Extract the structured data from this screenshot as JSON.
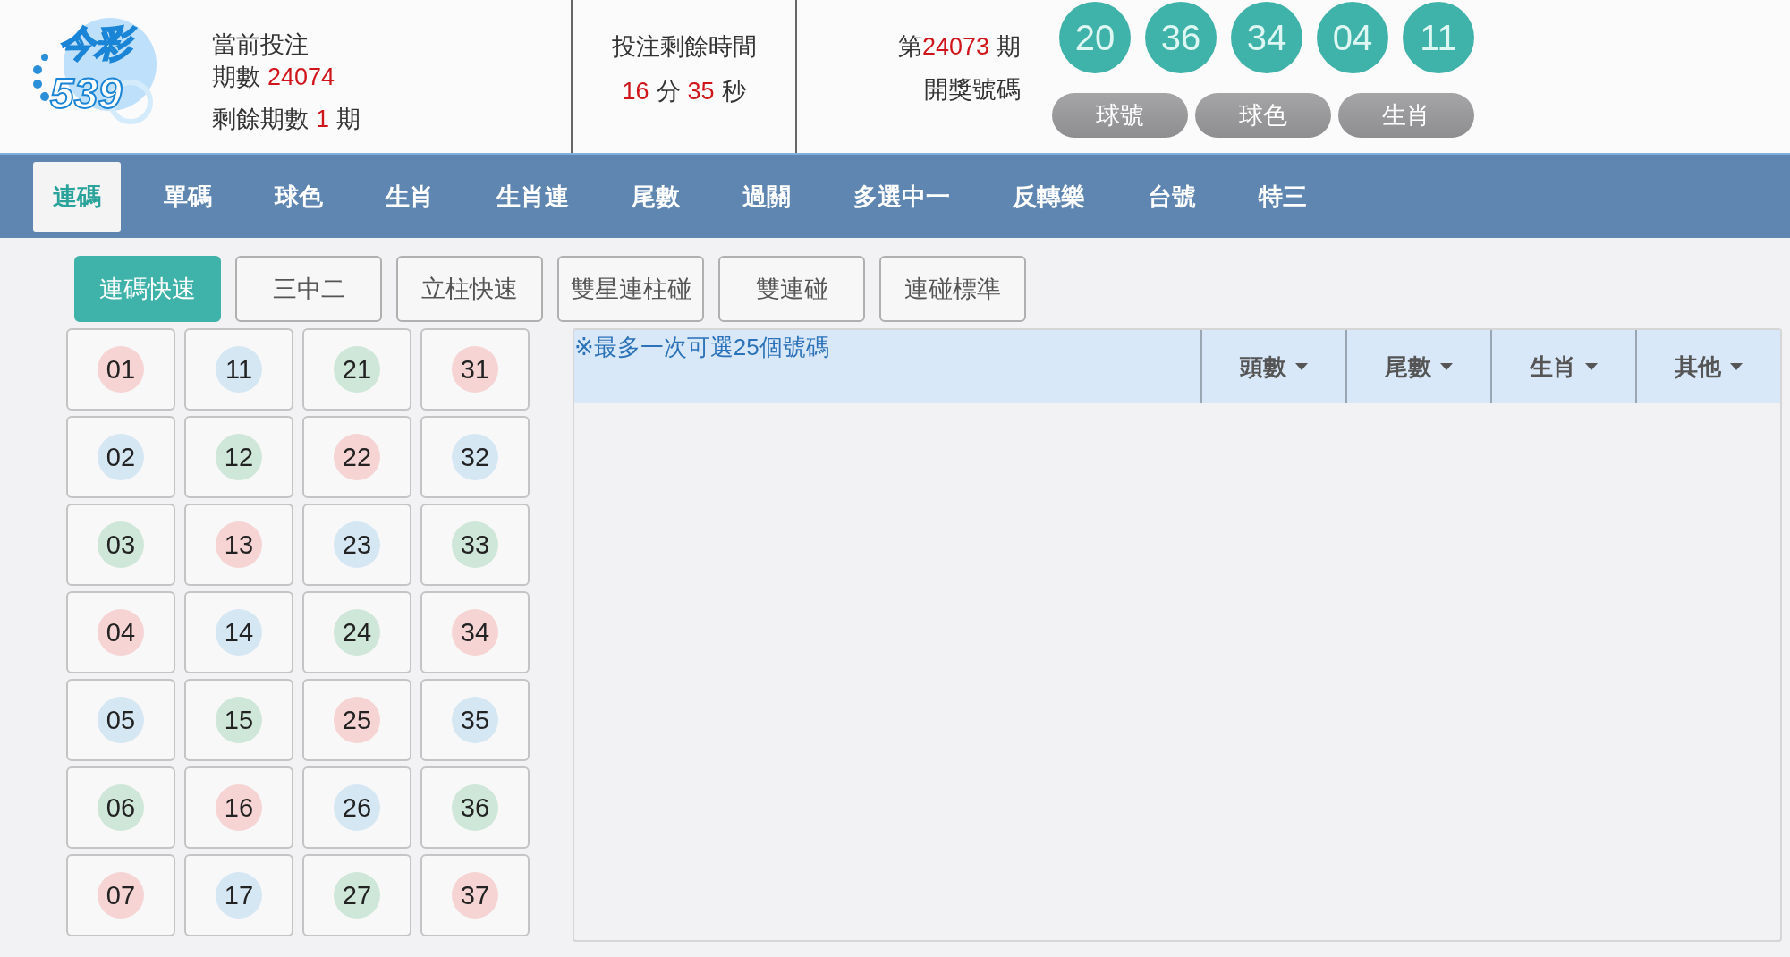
{
  "logo": {
    "line1": "今彩",
    "line2": "539"
  },
  "current_bet": {
    "title": "當前投注",
    "period_label": "期數",
    "period": "24074",
    "remaining_label": "剩餘期數",
    "remaining": "1",
    "remaining_unit": "期"
  },
  "countdown": {
    "title": "投注剩餘時間",
    "minutes": "16",
    "minutes_unit": "分",
    "seconds": "35",
    "seconds_unit": "秒"
  },
  "last_draw": {
    "prefix": "第",
    "period": "24073",
    "suffix": "期",
    "label": "開獎號碼",
    "balls": [
      "20",
      "36",
      "34",
      "04",
      "11"
    ],
    "view_buttons": [
      {
        "label": "球號",
        "selected": false
      },
      {
        "label": "球色",
        "selected": false
      },
      {
        "label": "生肖",
        "selected": false
      }
    ]
  },
  "nav_tabs": [
    {
      "label": "連碼",
      "selected": true
    },
    {
      "label": "單碼",
      "selected": false
    },
    {
      "label": "球色",
      "selected": false
    },
    {
      "label": "生肖",
      "selected": false
    },
    {
      "label": "生肖連",
      "selected": false
    },
    {
      "label": "尾數",
      "selected": false
    },
    {
      "label": "過關",
      "selected": false
    },
    {
      "label": "多選中一",
      "selected": false
    },
    {
      "label": "反轉樂",
      "selected": false
    },
    {
      "label": "台號",
      "selected": false
    },
    {
      "label": "特三",
      "selected": false
    }
  ],
  "sub_tabs": [
    {
      "label": "連碼快速",
      "selected": true
    },
    {
      "label": "三中二",
      "selected": false
    },
    {
      "label": "立柱快速",
      "selected": false
    },
    {
      "label": "雙星連柱碰",
      "selected": false
    },
    {
      "label": "雙連碰",
      "selected": false
    },
    {
      "label": "連碰標準",
      "selected": false
    }
  ],
  "number_grid": [
    {
      "number": "01",
      "color": "#f6d4d4"
    },
    {
      "number": "11",
      "color": "#d6e7f4"
    },
    {
      "number": "21",
      "color": "#cfe7d9"
    },
    {
      "number": "31",
      "color": "#f6d4d4"
    },
    {
      "number": "02",
      "color": "#d6e7f4"
    },
    {
      "number": "12",
      "color": "#cfe7d9"
    },
    {
      "number": "22",
      "color": "#f6d4d4"
    },
    {
      "number": "32",
      "color": "#d6e7f4"
    },
    {
      "number": "03",
      "color": "#cfe7d9"
    },
    {
      "number": "13",
      "color": "#f6d4d4"
    },
    {
      "number": "23",
      "color": "#d6e7f4"
    },
    {
      "number": "33",
      "color": "#cfe7d9"
    },
    {
      "number": "04",
      "color": "#f6d4d4"
    },
    {
      "number": "14",
      "color": "#d6e7f4"
    },
    {
      "number": "24",
      "color": "#cfe7d9"
    },
    {
      "number": "34",
      "color": "#f6d4d4"
    },
    {
      "number": "05",
      "color": "#d6e7f4"
    },
    {
      "number": "15",
      "color": "#cfe7d9"
    },
    {
      "number": "25",
      "color": "#f6d4d4"
    },
    {
      "number": "35",
      "color": "#d6e7f4"
    },
    {
      "number": "06",
      "color": "#cfe7d9"
    },
    {
      "number": "16",
      "color": "#f6d4d4"
    },
    {
      "number": "26",
      "color": "#d6e7f4"
    },
    {
      "number": "36",
      "color": "#cfe7d9"
    },
    {
      "number": "07",
      "color": "#f6d4d4"
    },
    {
      "number": "17",
      "color": "#d6e7f4"
    },
    {
      "number": "27",
      "color": "#cfe7d9"
    },
    {
      "number": "37",
      "color": "#f6d4d4"
    }
  ],
  "selection_panel": {
    "note": "※最多一次可選25個號碼",
    "filters": [
      "頭數",
      "尾數",
      "生肖",
      "其他"
    ]
  }
}
